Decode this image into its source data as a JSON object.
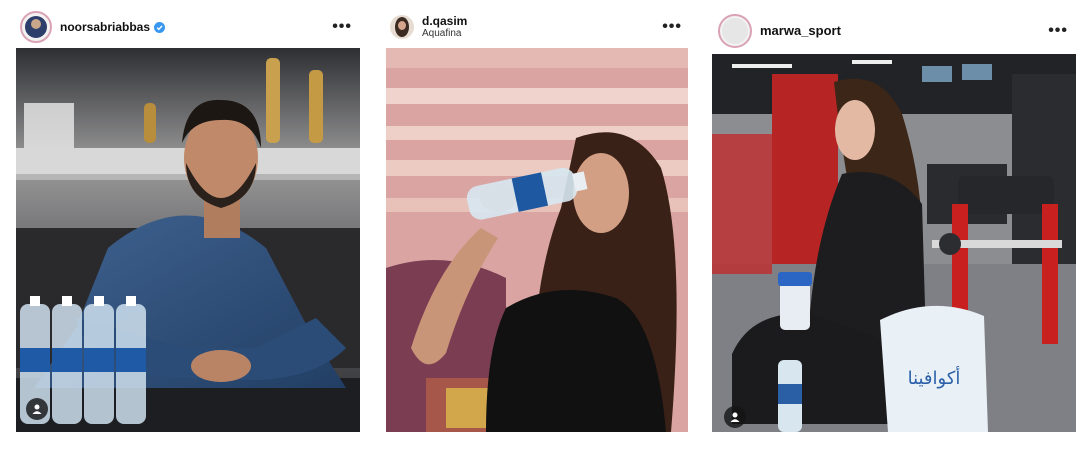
{
  "posts": [
    {
      "username": "noorsabriabbas",
      "subtitle": "",
      "verified": true,
      "more_icon": "more-horizontal-icon",
      "tag_icon": "user-tag-icon",
      "bottle_label": "AQUAFINA",
      "bottle_label_ar": "أكوافينا"
    },
    {
      "username": "d.qasim",
      "subtitle": "Aquafina",
      "verified": false,
      "more_icon": "more-horizontal-icon"
    },
    {
      "username": "marwa_sport",
      "subtitle": "",
      "verified": false,
      "more_icon": "more-horizontal-icon",
      "tag_icon": "user-tag-icon",
      "bag_text": "أكوافينا",
      "bag_logo": "أكوافينا"
    }
  ],
  "more_glyph": "•••",
  "colors": {
    "verified": "#3897f0",
    "avatar_ring": "#d9a3b3",
    "bag": "#e9f0f6",
    "gym_red": "#c8201f"
  }
}
